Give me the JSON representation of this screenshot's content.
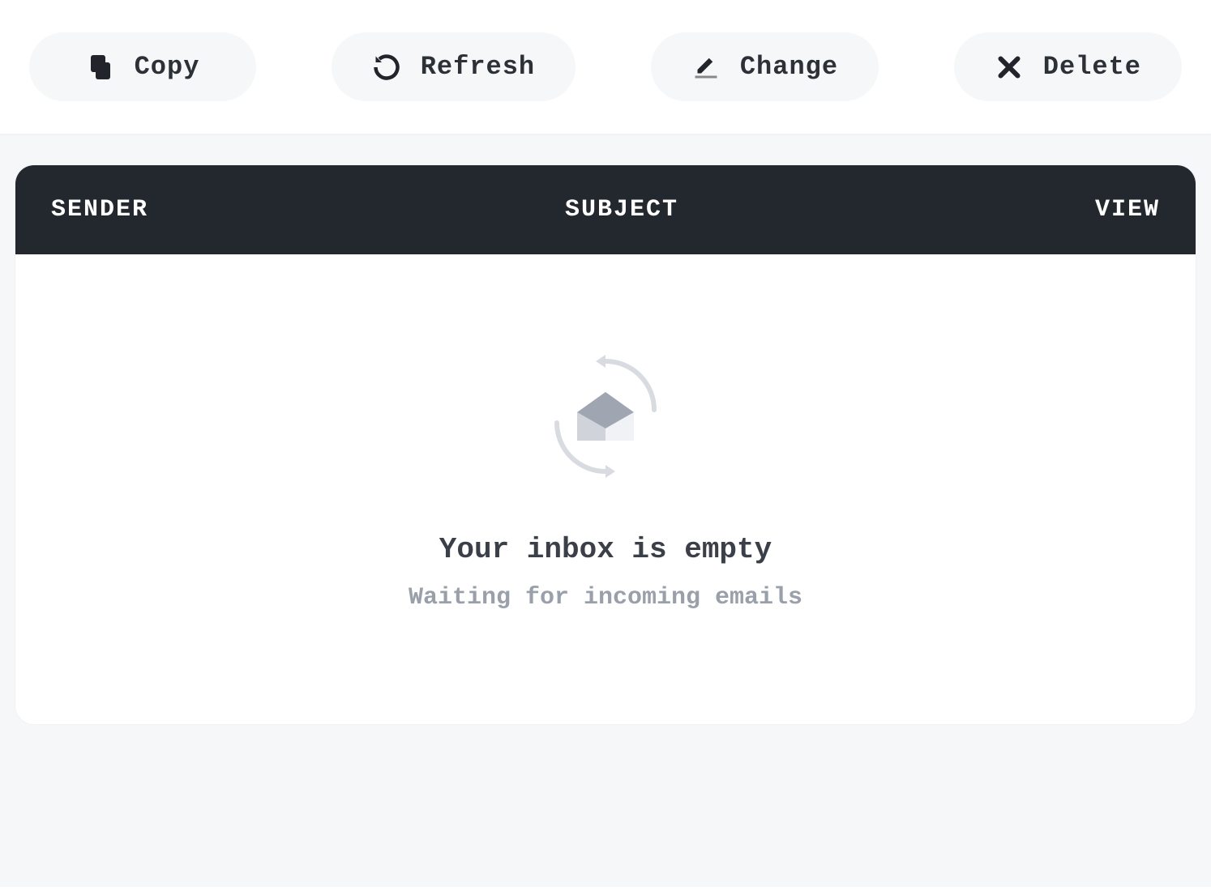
{
  "toolbar": {
    "copy_label": "Copy",
    "refresh_label": "Refresh",
    "change_label": "Change",
    "delete_label": "Delete"
  },
  "inbox": {
    "columns": {
      "sender": "SENDER",
      "subject": "SUBJECT",
      "view": "VIEW"
    },
    "empty": {
      "title": "Your inbox is empty",
      "subtitle": "Waiting for incoming emails"
    }
  }
}
